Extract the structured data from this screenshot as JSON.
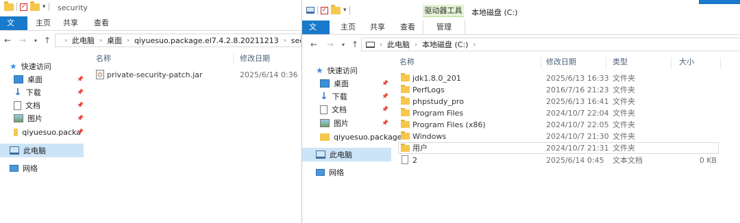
{
  "left": {
    "title": "security",
    "tabs": [
      "文件",
      "主页",
      "共享",
      "查看"
    ],
    "breadcrumb": [
      "此电脑",
      "桌面",
      "qiyuesuo.package.el7.4.2.8.20211213",
      "security"
    ],
    "nav": {
      "quick_access": "快速访问",
      "items": [
        "桌面",
        "下载",
        "文档",
        "图片",
        "qiyuesuo.packa"
      ],
      "this_pc": "此电脑",
      "network": "网络"
    },
    "columns": {
      "name": "名称",
      "modified": "修改日期"
    },
    "files": [
      {
        "name": "private-security-patch.jar",
        "modified": "2025/6/14 0:36"
      }
    ]
  },
  "right": {
    "context_tool": "驱动器工具",
    "title": "本地磁盘 (C:)",
    "tabs": [
      "文件",
      "主页",
      "共享",
      "查看"
    ],
    "context_tab": "管理",
    "breadcrumb": [
      "此电脑",
      "本地磁盘 (C:)"
    ],
    "nav": {
      "quick_access": "快速访问",
      "items": [
        "桌面",
        "下载",
        "文档",
        "图片",
        "qiyuesuo.package"
      ],
      "this_pc": "此电脑",
      "network": "网络"
    },
    "columns": {
      "name": "名称",
      "modified": "修改日期",
      "type": "类型",
      "size": "大小"
    },
    "files": [
      {
        "name": "jdk1.8.0_201",
        "modified": "2025/6/13 16:33",
        "type": "文件夹",
        "size": "",
        "kind": "folder"
      },
      {
        "name": "PerfLogs",
        "modified": "2016/7/16 21:23",
        "type": "文件夹",
        "size": "",
        "kind": "folder"
      },
      {
        "name": "phpstudy_pro",
        "modified": "2025/6/13 16:41",
        "type": "文件夹",
        "size": "",
        "kind": "folder"
      },
      {
        "name": "Program Files",
        "modified": "2024/10/7 22:04",
        "type": "文件夹",
        "size": "",
        "kind": "folder"
      },
      {
        "name": "Program Files (x86)",
        "modified": "2024/10/7 22:05",
        "type": "文件夹",
        "size": "",
        "kind": "folder"
      },
      {
        "name": "Windows",
        "modified": "2024/10/7 21:30",
        "type": "文件夹",
        "size": "",
        "kind": "folder"
      },
      {
        "name": "用户",
        "modified": "2024/10/7 21:31",
        "type": "文件夹",
        "size": "",
        "kind": "folder"
      },
      {
        "name": "2",
        "modified": "2025/6/14 0:45",
        "type": "文本文档",
        "size": "0 KB",
        "kind": "file"
      }
    ]
  },
  "colors": {
    "accent": "#1979ca",
    "selection": "#cce4f7",
    "folder": "#f5c84c",
    "context_group": "#e2f3d3"
  }
}
